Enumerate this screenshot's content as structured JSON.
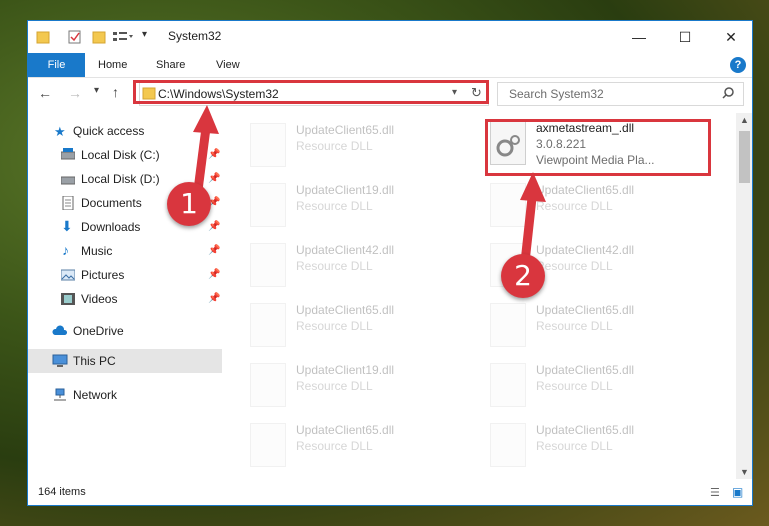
{
  "window": {
    "title": "System32"
  },
  "ribbon": {
    "tabs": [
      "File",
      "Home",
      "Share",
      "View"
    ],
    "help": "?"
  },
  "address": {
    "path": "C:\\Windows\\System32"
  },
  "search": {
    "placeholder": "Search System32"
  },
  "sidebar": {
    "items": [
      {
        "label": "Quick access",
        "icon": "star-icon"
      },
      {
        "label": "Local Disk (C:)",
        "icon": "drive-icon",
        "pinned": true
      },
      {
        "label": "Local Disk (D:)",
        "icon": "drive-icon",
        "pinned": true
      },
      {
        "label": "Documents",
        "icon": "documents-icon",
        "pinned": true
      },
      {
        "label": "Downloads",
        "icon": "download-icon",
        "pinned": true
      },
      {
        "label": "Music",
        "icon": "music-icon",
        "pinned": true
      },
      {
        "label": "Pictures",
        "icon": "pictures-icon",
        "pinned": true
      },
      {
        "label": "Videos",
        "icon": "videos-icon",
        "pinned": true
      },
      {
        "label": "OneDrive",
        "icon": "cloud-icon"
      },
      {
        "label": "This PC",
        "icon": "computer-icon",
        "selected": true
      },
      {
        "label": "Network",
        "icon": "network-icon"
      }
    ]
  },
  "files": {
    "left": [
      {
        "name": "UpdateClient65.dll",
        "type": "Resource DLL"
      },
      {
        "name": "UpdateClient19.dll",
        "type": "Resource DLL"
      },
      {
        "name": "UpdateClient42.dll",
        "type": "Resource DLL"
      },
      {
        "name": "UpdateClient65.dll",
        "type": "Resource DLL"
      },
      {
        "name": "UpdateClient19.dll",
        "type": "Resource DLL"
      },
      {
        "name": "UpdateClient65.dll",
        "type": "Resource DLL"
      }
    ],
    "highlighted": {
      "name": "axmetastream_.dll",
      "version": "3.0.8.221",
      "desc": "Viewpoint Media Pla..."
    },
    "right": [
      {
        "name": "UpdateClient65.dll",
        "type": "Resource DLL"
      },
      {
        "name": "UpdateClient42.dll",
        "type": "Resource DLL"
      },
      {
        "name": "UpdateClient65.dll",
        "type": "Resource DLL"
      },
      {
        "name": "UpdateClient65.dll",
        "type": "Resource DLL"
      },
      {
        "name": "UpdateClient65.dll",
        "type": "Resource DLL"
      }
    ]
  },
  "status": {
    "count": "164 items"
  },
  "annotations": {
    "step1": "1",
    "step2": "2"
  },
  "colors": {
    "accent": "#1979ca",
    "highlight": "#d9363e"
  }
}
